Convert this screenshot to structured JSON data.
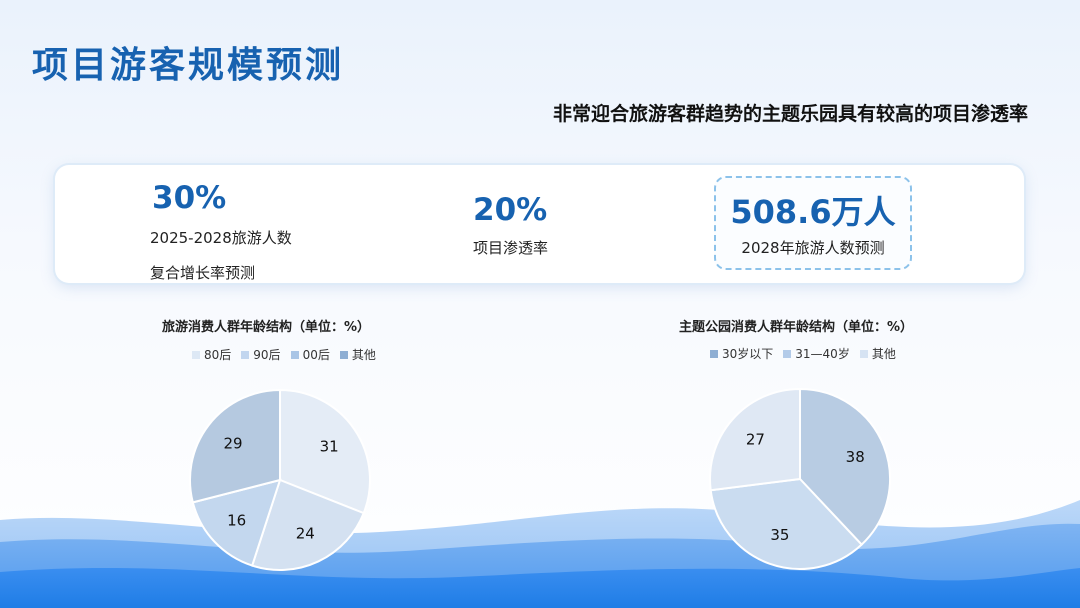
{
  "page": {
    "title": "项目游客规模预测",
    "subtitle": "非常迎合旅游客群趋势的主题乐园具有较高的项目渗透率"
  },
  "stats": [
    {
      "value": "30%",
      "label_line1": "2025-2028旅游人数",
      "label_line2": "复合增长率预测"
    },
    {
      "value": "20%",
      "label_line1": "项目渗透率",
      "label_line2": ""
    },
    {
      "value": "508.6万人",
      "label_line1": "2028年旅游人数预测",
      "label_line2": ""
    }
  ],
  "colors": {
    "accent": "#1762b0",
    "wave_light": "#a9ccf6",
    "wave_mid": "#6aa8f0",
    "wave_dark": "#2f86ec"
  },
  "chart_data": [
    {
      "type": "pie",
      "title": "旅游消费人群年龄结构（单位：%）",
      "legend_position": "top",
      "categories": [
        "80后",
        "90后",
        "00后",
        "其他"
      ],
      "values": [
        31,
        24,
        16,
        29
      ],
      "colors": [
        "#e4ecf6",
        "#d4e1f1",
        "#c3d7ee",
        "#b5c9e0"
      ],
      "swatch_colors": [
        "#dde8f5",
        "#c2d6ef",
        "#a9c5e6",
        "#8eaed3"
      ]
    },
    {
      "type": "pie",
      "title": "主题公园消费人群年龄结构（单位：%）",
      "legend_position": "top",
      "categories": [
        "30岁以下",
        "31—40岁",
        "其他"
      ],
      "values": [
        38,
        35,
        27
      ],
      "colors": [
        "#b8cce3",
        "#cadcf0",
        "#dfe8f4"
      ],
      "swatch_colors": [
        "#8eaed3",
        "#b3cbe9",
        "#d6e3f3"
      ]
    }
  ]
}
